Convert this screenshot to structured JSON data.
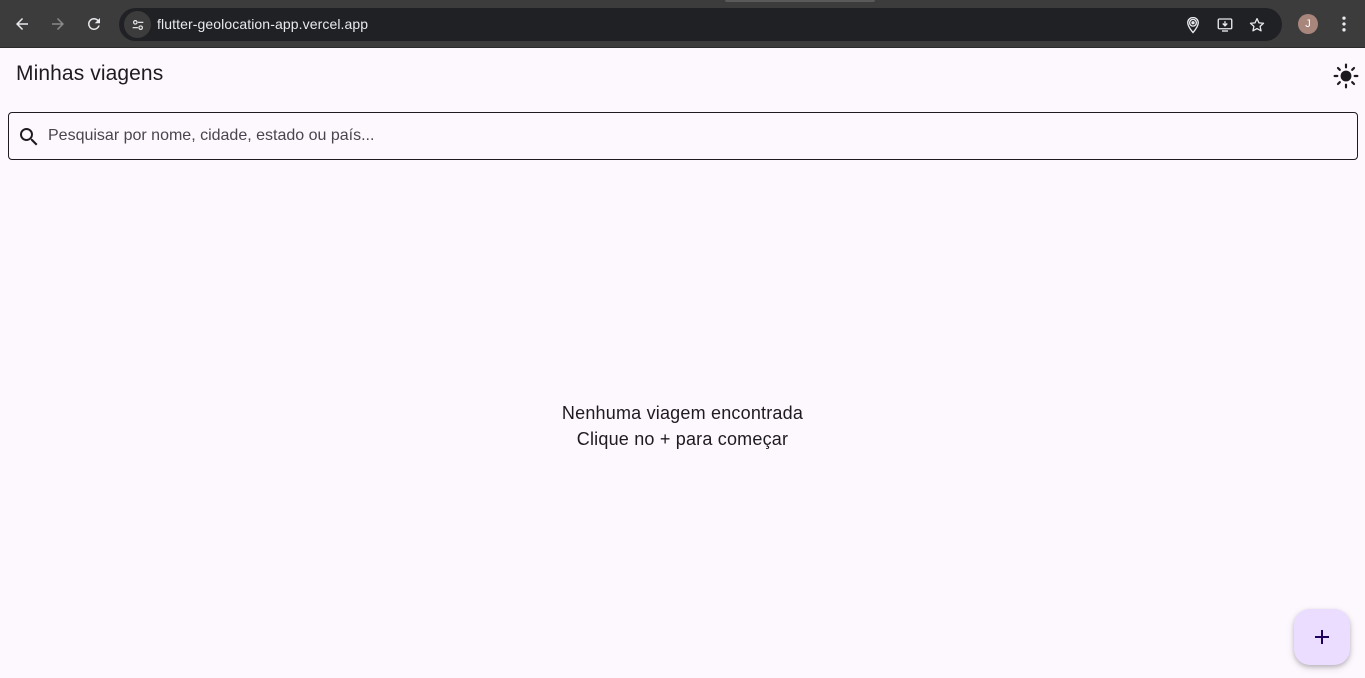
{
  "browser": {
    "url": "flutter-geolocation-app.vercel.app",
    "profile_initial": "J",
    "icons": {
      "back": "arrow-left-icon",
      "forward": "arrow-right-icon",
      "reload": "reload-icon",
      "site_info": "tune-icon",
      "location": "location-pin-icon",
      "install": "install-app-icon",
      "bookmark": "star-icon",
      "menu": "more-vertical-icon"
    }
  },
  "app": {
    "title": "Minhas viagens",
    "theme_toggle_icon": "sun-icon",
    "search": {
      "placeholder": "Pesquisar por nome, cidade, estado ou país...",
      "value": ""
    },
    "empty_state": {
      "line1": "Nenhuma viagem encontrada",
      "line2": "Clique no + para começar"
    },
    "fab_icon": "plus-icon"
  },
  "colors": {
    "background": "#fdf7fe",
    "fab_background": "#eaddff",
    "text_primary": "#1d1b20",
    "browser_toolbar": "#3c3c3c",
    "omnibox": "#202124"
  }
}
